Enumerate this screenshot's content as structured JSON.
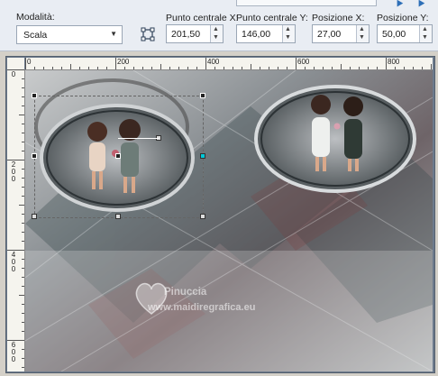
{
  "toolbar": {
    "mode_label": "Modalità:",
    "mode_value": "Scala",
    "center_x_label": "Punto centrale X:",
    "center_x_value": "201,50",
    "center_y_label": "Punto centrale Y:",
    "center_y_value": "146,00",
    "pos_x_label": "Posizione X:",
    "pos_x_value": "27,00",
    "pos_y_label": "Posizione Y:",
    "pos_y_value": "50,00",
    "icons": [
      "pick-tool-icon",
      "arrow-icon",
      "arrow-icon"
    ]
  },
  "ruler": {
    "top_labels": [
      "0",
      "200",
      "400",
      "600",
      "800"
    ],
    "left_labels": [
      "0",
      "2\n0\n0",
      "4\n0\n0",
      "6\n0\n0"
    ]
  },
  "watermark": {
    "name": "Pinuccia",
    "site": "www.maidiregrafica.eu"
  },
  "colors": {
    "toolbar_bg": "#e9edf3",
    "selection_handle": "#ffffff",
    "accent_handle": "#00c8d8"
  }
}
